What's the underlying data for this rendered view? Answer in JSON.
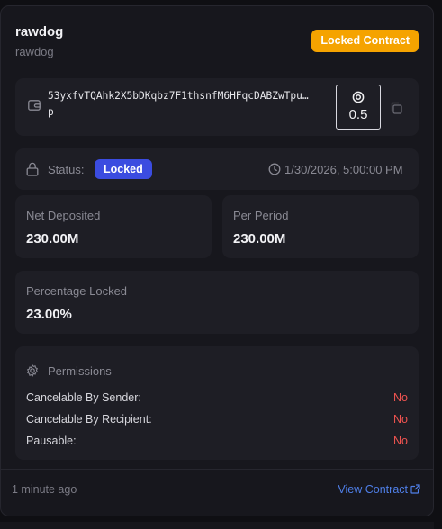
{
  "contract": {
    "title": "rawdog",
    "subtitle": "rawdog",
    "type_badge": "Locked Contract"
  },
  "address": {
    "line1": "53yxfvTQAhk2X5bDKqbz7F1thsnfM6HFqcDABZwTpu…",
    "line2": "p",
    "qr_value": "0.5"
  },
  "status": {
    "label": "Status:",
    "value": "Locked",
    "datetime": "1/30/2026, 5:00:00 PM"
  },
  "stats": {
    "net_deposited_label": "Net Deposited",
    "net_deposited_value": "230.00M",
    "per_period_label": "Per Period",
    "per_period_value": "230.00M",
    "percentage_locked_label": "Percentage Locked",
    "percentage_locked_value": "23.00%"
  },
  "permissions": {
    "title": "Permissions",
    "rows": [
      {
        "label": "Cancelable By Sender:",
        "value": "No"
      },
      {
        "label": "Cancelable By Recipient:",
        "value": "No"
      },
      {
        "label": "Pausable:",
        "value": "No"
      }
    ]
  },
  "footer": {
    "time_ago": "1 minute ago",
    "link_label": "View Contract"
  },
  "colors": {
    "badge_orange": "#f5a300",
    "status_blue": "#3b4ce0",
    "no_red": "#ef5350",
    "link_blue": "#4f7fe8"
  },
  "icons": [
    "wallet-icon",
    "eye-icon",
    "copy-icon",
    "lock-icon",
    "clock-icon",
    "gear-icon",
    "external-link-icon"
  ]
}
